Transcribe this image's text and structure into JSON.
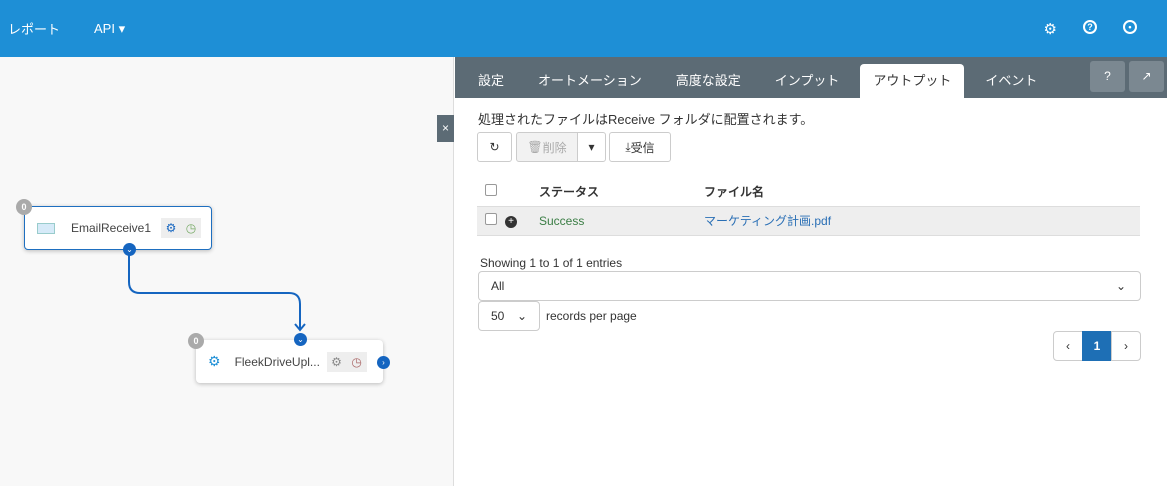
{
  "header": {
    "nav": [
      "レポート",
      "API"
    ],
    "icons": [
      "gear-icon",
      "help-icon",
      "user-icon"
    ]
  },
  "canvas": {
    "nodes": [
      {
        "name": "EmailReceive1",
        "count": "0"
      },
      {
        "name": "FleekDriveUpl...",
        "count": "0"
      }
    ],
    "close": "×"
  },
  "panel": {
    "tabs": [
      "設定",
      "オートメーション",
      "高度な設定",
      "インプット",
      "アウトプット",
      "イベント"
    ],
    "active_tab": "アウトプット",
    "message": "処理されたファイルはReceive フォルダに配置されます。",
    "toolbar": {
      "delete": "削除",
      "receive": "受信"
    },
    "table": {
      "headers": [
        "ステータス",
        "ファイル名"
      ],
      "rows": [
        {
          "status": "Success",
          "file": "マーケティング計画.pdf"
        }
      ]
    },
    "info": "Showing 1 to 1 of 1 entries",
    "filter": "All",
    "page_size": "50",
    "per_page_label": "records per page",
    "page": "1"
  },
  "colors": {
    "header": "#1e8fd6",
    "tabs": "#5c6b75",
    "success": "#3a7d44",
    "link": "#2a6fb5"
  }
}
